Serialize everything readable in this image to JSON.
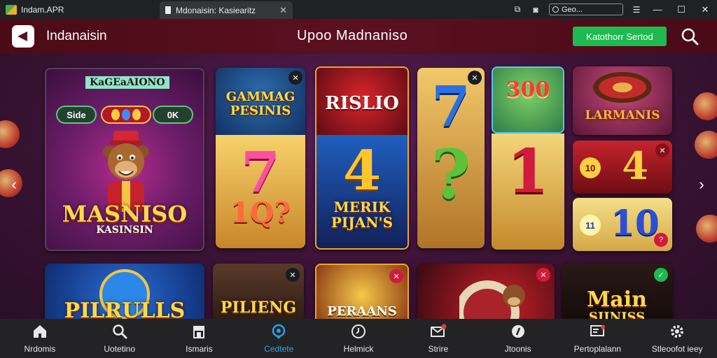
{
  "window": {
    "app_title": "Indam.APR",
    "tab_label": "Mdonaisin: Kasiearitz",
    "address_text": "Geo..."
  },
  "header": {
    "brand": "Indanaisin",
    "promo": "Upoo  Madnaniso",
    "cta_label": "Katothorr Sertod"
  },
  "featured": {
    "label": "KaGEaAIONO",
    "pill_left": "Side",
    "pill_right": "0K",
    "name": "MASNISO",
    "subname": "KASINSIN"
  },
  "games_top": [
    {
      "title": "GAMMAG PESINIS",
      "number": "7",
      "number_suffix": "1Q?"
    },
    {
      "title": "RISLIO",
      "number": "4",
      "subtitle": "MERIK PIJAN'S"
    },
    {
      "title": "",
      "number": "7",
      "number2": "?"
    },
    {
      "title": "300",
      "number": "1"
    },
    {
      "title": "LARMANIS",
      "number": "4",
      "chip": "10"
    },
    {
      "number": "10",
      "chip": "11"
    }
  ],
  "games_bottom": [
    {
      "title": "PILRULLS"
    },
    {
      "title": "PILIENG"
    },
    {
      "title": "PERAANS"
    },
    {
      "title": ""
    },
    {
      "title": "Main",
      "subtitle": "SIINISS"
    }
  ],
  "nav": [
    {
      "label": "Nrdomis",
      "icon": "home-icon",
      "active": false
    },
    {
      "label": "Uotetino",
      "icon": "search-icon",
      "active": false
    },
    {
      "label": "Ismaris",
      "icon": "store-icon",
      "active": false
    },
    {
      "label": "Cedtete",
      "icon": "location-icon",
      "active": true
    },
    {
      "label": "Helmick",
      "icon": "clock-icon",
      "active": false
    },
    {
      "label": "Strire",
      "icon": "mail-icon",
      "active": false
    },
    {
      "label": "Jtoonis",
      "icon": "pin-icon",
      "active": false
    },
    {
      "label": "Pertoplalann",
      "icon": "message-icon",
      "active": false
    },
    {
      "label": "Stleoofot ieey",
      "icon": "gear-icon",
      "active": false
    }
  ],
  "colors": {
    "header_bg": "#5b1020",
    "cta_green": "#1eb94f",
    "active_nav": "#2aa3e0",
    "gold": "#ffd84a"
  }
}
